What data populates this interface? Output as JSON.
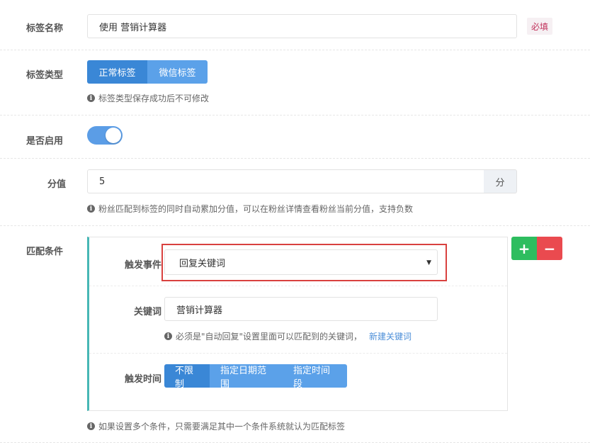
{
  "tag_name": {
    "label": "标签名称",
    "value": "使用 营销计算器",
    "required": "必填"
  },
  "tag_type": {
    "label": "标签类型",
    "options": [
      "正常标签",
      "微信标签"
    ],
    "selected": "正常标签",
    "hint": "标签类型保存成功后不可修改"
  },
  "enabled": {
    "label": "是否启用",
    "value": true
  },
  "score": {
    "label": "分值",
    "value": "5",
    "unit": "分",
    "hint": "粉丝匹配到标签的同时自动累加分值，可以在粉丝详情查看粉丝当前分值，支持负数"
  },
  "match": {
    "label": "匹配条件",
    "trigger_event": {
      "label": "触发事件",
      "selected": "回复关键词"
    },
    "keyword": {
      "label": "关键词",
      "value": "营销计算器",
      "hint": "必须是\"自动回复\"设置里面可以匹配到的关键词，",
      "link": "新建关键词"
    },
    "trigger_time": {
      "label": "触发时间",
      "options": [
        "不限制",
        "指定日期范围",
        "指定时间段"
      ],
      "selected": "不限制"
    },
    "hint": "如果设置多个条件，只需要满足其中一个条件系统就认为匹配标签"
  },
  "icons": {
    "info": "info-icon",
    "plus": "plus-icon",
    "minus": "minus-icon",
    "caret": "caret-down-icon"
  },
  "colors": {
    "primary_active": "#3a87d6",
    "primary": "#5ba1e9",
    "toggle_on": "#5b9de6",
    "add": "#2ebd5f",
    "remove": "#ea4a4f",
    "highlight": "#d9413f",
    "condition_accent": "#47b7b5",
    "required_text": "#c0305a"
  }
}
